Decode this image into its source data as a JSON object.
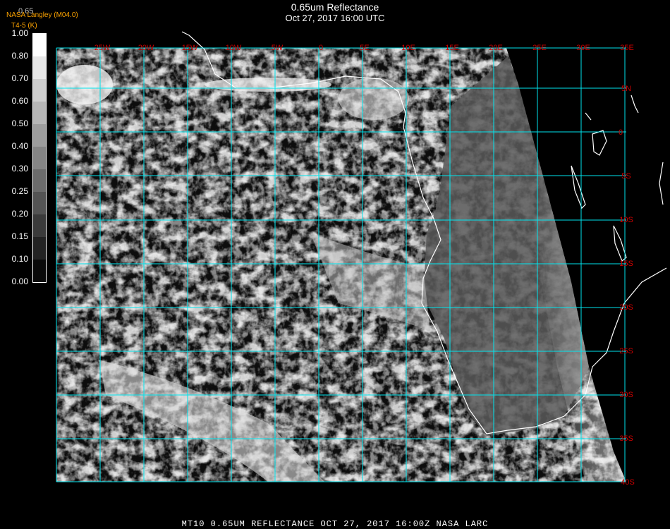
{
  "title": "0.65um Reflectance",
  "subtitle": "Oct 27, 2017 16:00 UTC",
  "credit": "NASA Langley (M04.0)",
  "credit2": "T4-5 (K)",
  "current_value": "0.65",
  "legend": {
    "ticks": [
      "1.00",
      "0.80",
      "0.70",
      "0.60",
      "0.50",
      "0.40",
      "0.30",
      "0.25",
      "0.20",
      "0.15",
      "0.10",
      "0.00"
    ]
  },
  "map": {
    "lon_labels": [
      "25W",
      "20W",
      "15W",
      "10W",
      "5W",
      "0",
      "5E",
      "10E",
      "15E",
      "20E",
      "25E",
      "30E",
      "35E"
    ],
    "lat_labels": [
      "5N",
      "0",
      "5S",
      "10S",
      "15S",
      "20S",
      "25S",
      "30S",
      "35S",
      "40S"
    ],
    "grid_color": "#00e5ee",
    "label_color": "#cc0000",
    "coast_color": "#ffffff"
  },
  "footer": "MT10  0.65UM REFLECTANCE   OCT 27, 2017 16:00Z   NASA LARC"
}
